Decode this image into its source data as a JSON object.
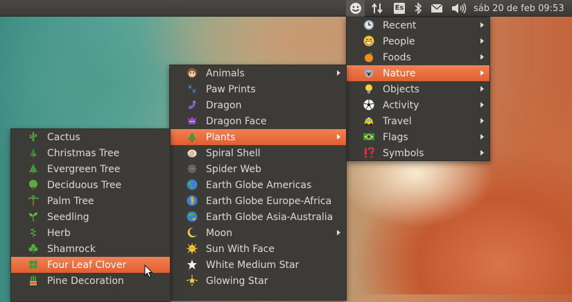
{
  "topbar": {
    "indicators": [
      "emoji-indicator-icon",
      "network-transfer-icon",
      "keyboard-layout-indicator",
      "bluetooth-icon",
      "mail-icon",
      "volume-icon"
    ],
    "keyboard_layout": "Es",
    "clock": "sáb 20 de feb 09:53"
  },
  "menu_main": {
    "items": [
      {
        "label": "Recent",
        "icon": "clock-icon",
        "submenu": true
      },
      {
        "label": "People",
        "icon": "grinning-face-icon",
        "submenu": true
      },
      {
        "label": "Foods",
        "icon": "tangerine-icon",
        "submenu": true
      },
      {
        "label": "Nature",
        "icon": "koala-icon",
        "submenu": true,
        "active": true
      },
      {
        "label": "Objects",
        "icon": "light-bulb-icon",
        "submenu": true
      },
      {
        "label": "Activity",
        "icon": "soccer-ball-icon",
        "submenu": true
      },
      {
        "label": "Travel",
        "icon": "taxi-icon",
        "submenu": true
      },
      {
        "label": "Flags",
        "icon": "brazil-flag-icon",
        "submenu": true
      },
      {
        "label": "Symbols",
        "icon": "exclamation-question-icon",
        "submenu": true
      }
    ]
  },
  "menu_nature": {
    "items": [
      {
        "label": "Animals",
        "icon": "monkey-face-icon",
        "submenu": true
      },
      {
        "label": "Paw Prints",
        "icon": "paw-prints-icon"
      },
      {
        "label": "Dragon",
        "icon": "dragon-icon"
      },
      {
        "label": "Dragon Face",
        "icon": "dragon-face-icon"
      },
      {
        "label": "Plants",
        "icon": "tree-icon",
        "submenu": true,
        "active": true
      },
      {
        "label": "Spiral Shell",
        "icon": "spiral-shell-icon"
      },
      {
        "label": "Spider Web",
        "icon": "spider-web-icon"
      },
      {
        "label": "Earth Globe Americas",
        "icon": "earth-globe-americas-icon"
      },
      {
        "label": "Earth Globe Europe-Africa",
        "icon": "earth-globe-europe-africa-icon"
      },
      {
        "label": "Earth Globe Asia-Australia",
        "icon": "earth-globe-asia-australia-icon"
      },
      {
        "label": "Moon",
        "icon": "crescent-moon-icon",
        "submenu": true
      },
      {
        "label": "Sun With Face",
        "icon": "sun-with-face-icon"
      },
      {
        "label": "White Medium Star",
        "icon": "white-medium-star-icon"
      },
      {
        "label": "Glowing Star",
        "icon": "glowing-star-icon"
      }
    ]
  },
  "menu_plants": {
    "items": [
      {
        "label": "Cactus",
        "icon": "cactus-icon"
      },
      {
        "label": "Christmas Tree",
        "icon": "christmas-tree-icon"
      },
      {
        "label": "Evergreen Tree",
        "icon": "evergreen-tree-icon"
      },
      {
        "label": "Deciduous Tree",
        "icon": "deciduous-tree-icon"
      },
      {
        "label": "Palm Tree",
        "icon": "palm-tree-icon"
      },
      {
        "label": "Seedling",
        "icon": "seedling-icon"
      },
      {
        "label": "Herb",
        "icon": "herb-icon"
      },
      {
        "label": "Shamrock",
        "icon": "shamrock-icon"
      },
      {
        "label": "Four Leaf Clover",
        "icon": "four-leaf-clover-icon",
        "active": true
      },
      {
        "label": "Pine Decoration",
        "icon": "pine-decoration-icon"
      }
    ]
  },
  "colors": {
    "panel": "#3b3a36",
    "menu_bg": "#3c3b37",
    "highlight": "#e8693a",
    "menu_text": "#dfdbd2"
  }
}
